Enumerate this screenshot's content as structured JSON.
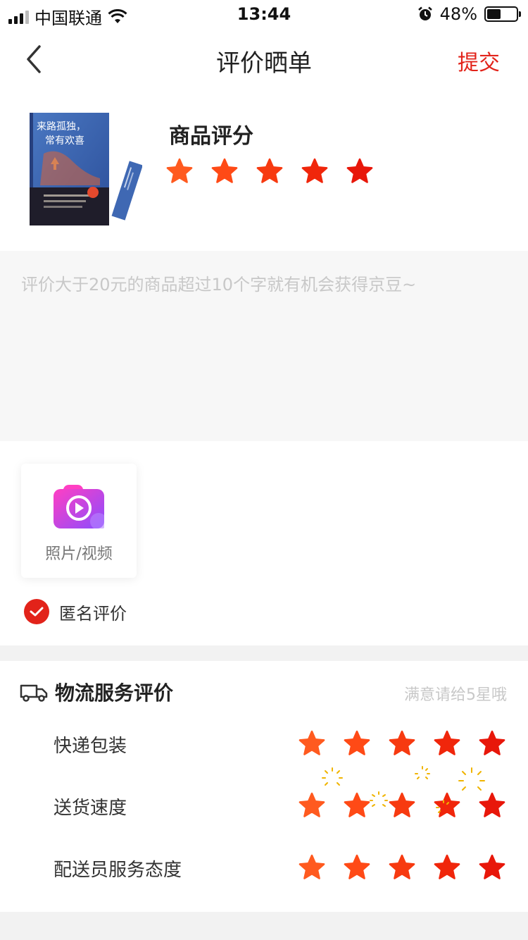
{
  "status_bar": {
    "carrier": "中国联通",
    "time": "13:44",
    "battery": "48%",
    "battery_level": 0.48
  },
  "nav": {
    "title": "评价晒单",
    "submit_label": "提交",
    "back_icon": "chevron-left-icon"
  },
  "product": {
    "book_cover_title_line1": "来路孤独，",
    "book_cover_title_line2": "常有欢喜",
    "rating_title": "商品评分",
    "rating": 5,
    "star_colors": [
      "#ff5a1f",
      "#ff4a16",
      "#f73a10",
      "#f0260b",
      "#e8170a"
    ]
  },
  "review": {
    "placeholder": "评价大于20元的商品超过10个字就有机会获得京豆~"
  },
  "media": {
    "upload_label": "照片/视频",
    "upload_icon": "camera-video-icon",
    "anonymous_label": "匿名评价",
    "anonymous_checked": true
  },
  "logistics": {
    "title": "物流服务评价",
    "hint": "满意请给5星哦",
    "icon": "truck-icon",
    "rows": [
      {
        "label": "快递包装",
        "rating": 5
      },
      {
        "label": "送货速度",
        "rating": 5
      },
      {
        "label": "配送员服务态度",
        "rating": 5
      }
    ]
  },
  "colors": {
    "accent": "#e2231a",
    "placeholder": "#c8c8c8"
  }
}
